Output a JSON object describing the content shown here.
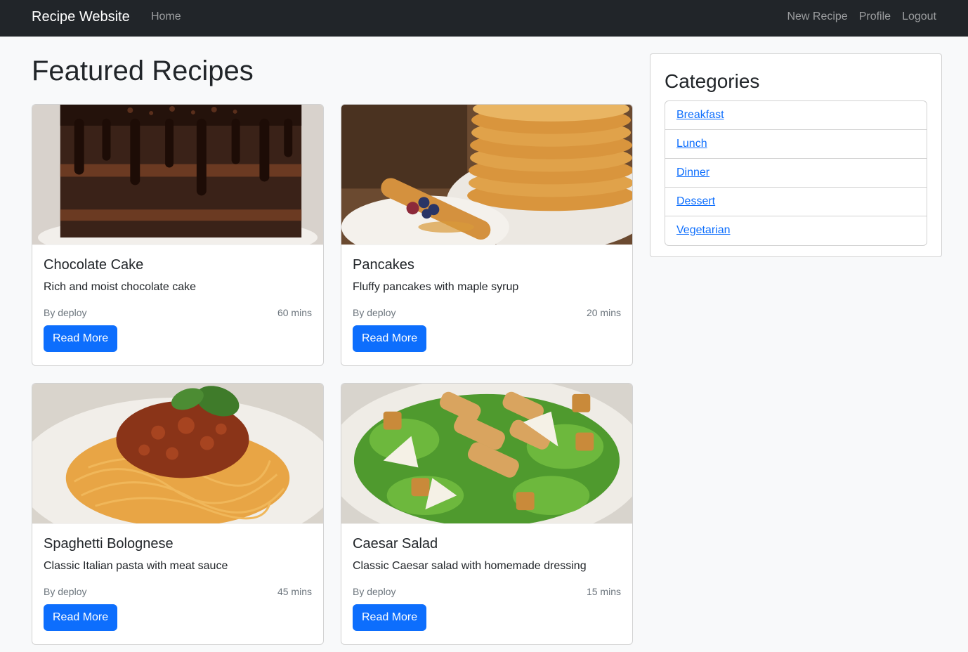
{
  "navbar": {
    "brand": "Recipe Website",
    "home": "Home",
    "new_recipe": "New Recipe",
    "profile": "Profile",
    "logout": "Logout"
  },
  "main": {
    "title": "Featured Recipes"
  },
  "recipes": [
    {
      "title": "Chocolate Cake",
      "description": "Rich and moist chocolate cake",
      "author": "By deploy",
      "time": "60 mins",
      "button": "Read More",
      "image": "chocolate-cake-image"
    },
    {
      "title": "Pancakes",
      "description": "Fluffy pancakes with maple syrup",
      "author": "By deploy",
      "time": "20 mins",
      "button": "Read More",
      "image": "pancakes-image"
    },
    {
      "title": "Spaghetti Bolognese",
      "description": "Classic Italian pasta with meat sauce",
      "author": "By deploy",
      "time": "45 mins",
      "button": "Read More",
      "image": "spaghetti-image"
    },
    {
      "title": "Caesar Salad",
      "description": "Classic Caesar salad with homemade dressing",
      "author": "By deploy",
      "time": "15 mins",
      "button": "Read More",
      "image": "caesar-salad-image"
    }
  ],
  "sidebar": {
    "title": "Categories",
    "items": [
      "Breakfast",
      "Lunch",
      "Dinner",
      "Dessert",
      "Vegetarian"
    ]
  },
  "colors": {
    "navbar_bg": "#212529",
    "primary": "#0d6efd",
    "page_bg": "#f8f9fa"
  }
}
